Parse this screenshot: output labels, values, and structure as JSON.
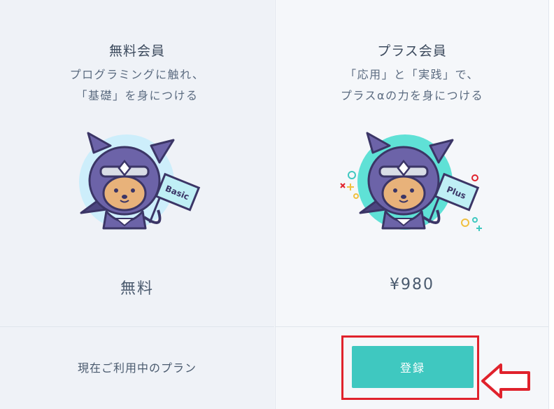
{
  "plans": [
    {
      "name": "無料会員",
      "tagline_line1": "プログラミングに触れ、",
      "tagline_line2": "「基礎」を身につける",
      "flag_label": "Basic",
      "price": "無料",
      "footer_text": "現在ご利用中のプラン"
    },
    {
      "name": "プラス会員",
      "tagline_line1": "「応用」と「実践」で、",
      "tagline_line2": "プラスαの力を身につける",
      "flag_label": "Plus",
      "price": "¥980",
      "button_label": "登録"
    }
  ],
  "colors": {
    "accent": "#3fc8c0",
    "highlight": "#e0222c",
    "free_circle": "#cdeefb",
    "plus_circle": "#5fe1d6",
    "ninja_purple": "#6c63a8"
  }
}
